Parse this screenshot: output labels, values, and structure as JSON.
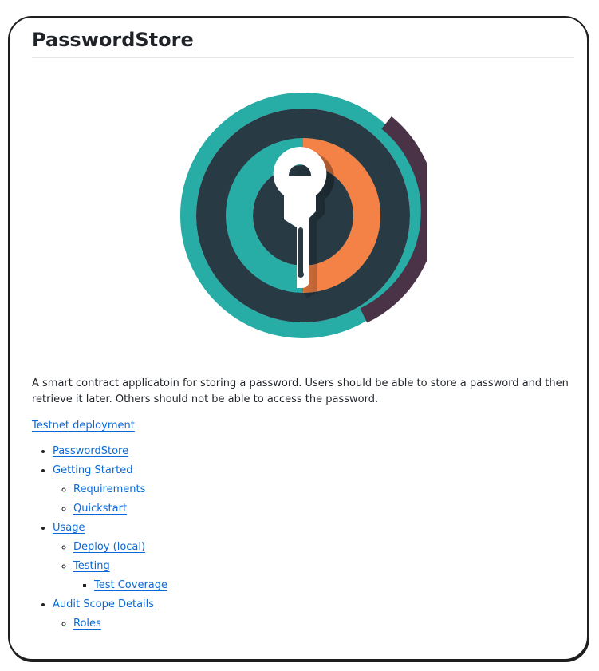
{
  "page": {
    "title": "PasswordStore",
    "description": "A smart contract applicatoin for storing a password. Users should be able to store a password and then retrieve it later. Others should not be able to access the password.",
    "testnet_link": "Testnet deployment"
  },
  "logo": {
    "icon": "key-logo-icon",
    "colors": {
      "teal": "#27aca6",
      "dark": "#283a44",
      "plum": "#4a3347",
      "orange": "#f48146",
      "key": "#ffffff"
    }
  },
  "toc": {
    "passwordstore": "PasswordStore",
    "getting_started": "Getting Started",
    "requirements": "Requirements",
    "quickstart": "Quickstart",
    "usage": "Usage",
    "deploy_local": "Deploy (local)",
    "testing": "Testing",
    "test_coverage": "Test Coverage",
    "audit_scope": "Audit Scope Details",
    "roles": "Roles"
  }
}
